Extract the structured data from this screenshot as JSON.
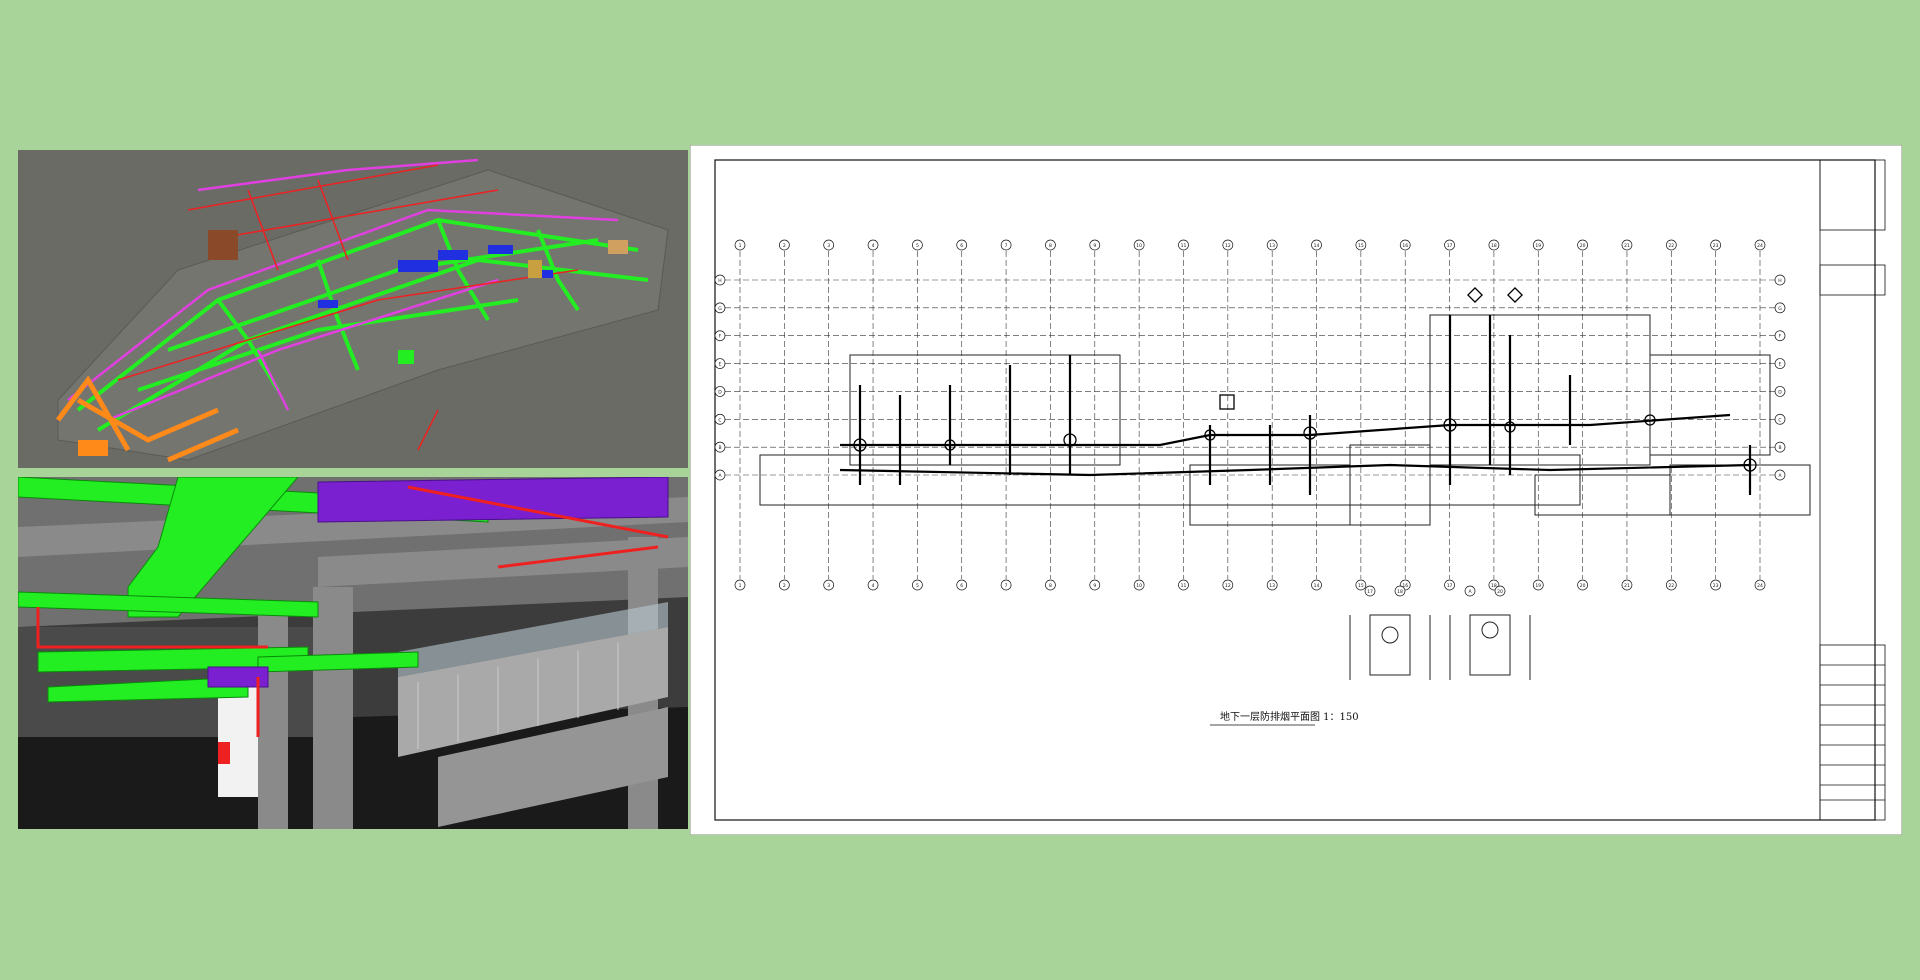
{
  "drawing": {
    "title": "地下一层防排烟平面图 1：150",
    "grid_columns": [
      "1",
      "2",
      "3",
      "4",
      "5",
      "6",
      "7",
      "8",
      "9",
      "10",
      "11",
      "12",
      "13",
      "14",
      "15",
      "16",
      "17",
      "18",
      "19",
      "20",
      "21",
      "22",
      "23",
      "24"
    ],
    "grid_rows": [
      "H",
      "G",
      "F",
      "E",
      "D",
      "C",
      "B",
      "A"
    ],
    "detail_markers": [
      "17",
      "18",
      "A",
      "20"
    ]
  },
  "colors": {
    "background": "#a8d49a",
    "duct_green": "#22ee22",
    "duct_magenta": "#e040e0",
    "pipe_red": "#ee2020",
    "pipe_orange": "#ff8a1a",
    "pipe_blue": "#2030e0",
    "pipe_purple": "#7a20d0"
  },
  "views": [
    "mep-3d-overview",
    "mep-3d-interior",
    "smoke-exhaust-floor-plan"
  ]
}
